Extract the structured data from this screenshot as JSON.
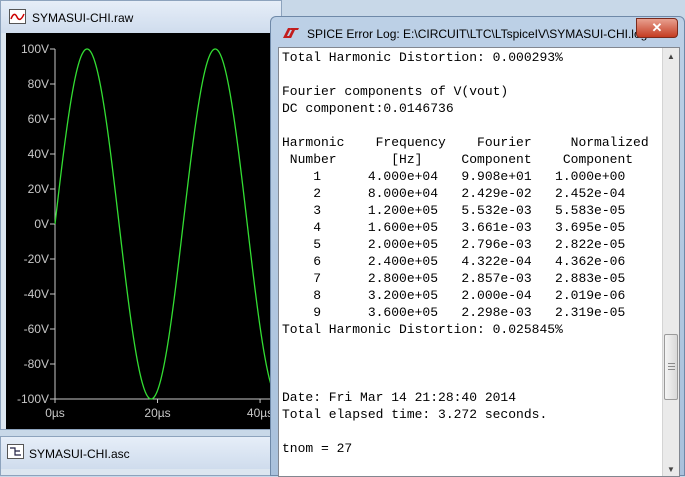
{
  "wave_window": {
    "title": "SYMASUI-CHI.raw",
    "icon": "waveform-icon",
    "chart_data": {
      "type": "line",
      "series": [
        {
          "color": "#33dd33",
          "signal": "V(vout)",
          "amplitude": 100,
          "frequency_hz": 40000
        }
      ],
      "x_ticks": [
        "0µs",
        "20µs",
        "40µs"
      ],
      "x_values_us": [
        0,
        20,
        40
      ],
      "y_ticks": [
        "100V",
        "80V",
        "60V",
        "40V",
        "20V",
        "0V",
        "-20V",
        "-40V",
        "-60V",
        "-80V",
        "-100V"
      ],
      "y_values": [
        100,
        80,
        60,
        40,
        20,
        0,
        -20,
        -40,
        -60,
        -80,
        -100
      ],
      "xlim_us": [
        0,
        43.5
      ],
      "ylim": [
        -100,
        100
      ],
      "grid": false,
      "background": "#000000",
      "axis_color": "#c8c8c8"
    }
  },
  "asc_window": {
    "title": "SYMASUI-CHI.asc",
    "icon": "schematic-icon"
  },
  "log_window": {
    "title": "SPICE Error Log: E:\\CIRCUIT\\LTC\\LTspiceIV\\SYMASUI-CHI.log",
    "icon": "ltspice-logo-icon",
    "close_label": "✕",
    "lines": [
      "Total Harmonic Distortion: 0.000293%",
      "",
      "Fourier components of V(vout)",
      "DC component:0.0146736",
      "",
      "Harmonic    Frequency    Fourier     Normalized",
      " Number       [Hz]     Component    Component",
      "    1      4.000e+04   9.908e+01   1.000e+00",
      "    2      8.000e+04   2.429e-02   2.452e-04",
      "    3      1.200e+05   5.532e-03   5.583e-05",
      "    4      1.600e+05   3.661e-03   3.695e-05",
      "    5      2.000e+05   2.796e-03   2.822e-05",
      "    6      2.400e+05   4.322e-04   4.362e-06",
      "    7      2.800e+05   2.857e-03   2.883e-05",
      "    8      3.200e+05   2.000e-04   2.019e-06",
      "    9      3.600e+05   2.298e-03   2.319e-05",
      "Total Harmonic Distortion: 0.025845%",
      "",
      "",
      "",
      "Date: Fri Mar 14 21:28:40 2014",
      "Total elapsed time: 3.272 seconds.",
      "",
      "tnom = 27"
    ]
  }
}
